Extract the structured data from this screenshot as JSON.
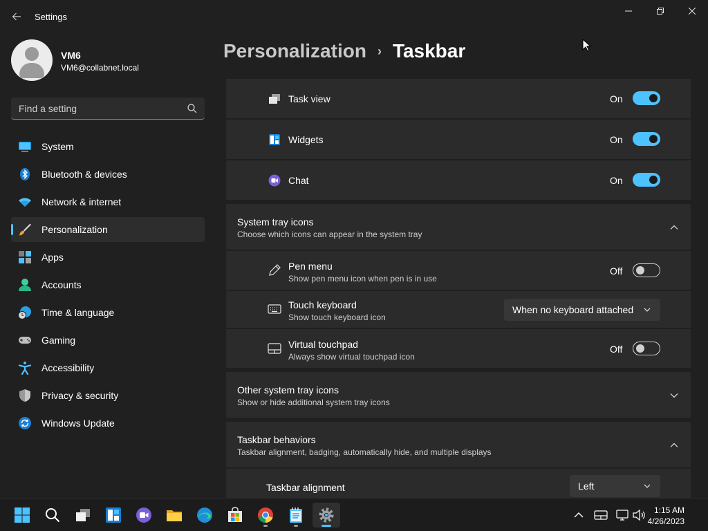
{
  "window": {
    "title": "Settings"
  },
  "user": {
    "name": "VM6",
    "email": "VM6@collabnet.local"
  },
  "search": {
    "placeholder": "Find a setting"
  },
  "sidebar": {
    "items": [
      {
        "label": "System",
        "icon": "system-icon"
      },
      {
        "label": "Bluetooth & devices",
        "icon": "bluetooth-icon"
      },
      {
        "label": "Network & internet",
        "icon": "wifi-icon"
      },
      {
        "label": "Personalization",
        "icon": "brush-icon",
        "active": true
      },
      {
        "label": "Apps",
        "icon": "apps-icon"
      },
      {
        "label": "Accounts",
        "icon": "accounts-icon"
      },
      {
        "label": "Time & language",
        "icon": "clock-globe-icon"
      },
      {
        "label": "Gaming",
        "icon": "gamepad-icon"
      },
      {
        "label": "Accessibility",
        "icon": "accessibility-icon"
      },
      {
        "label": "Privacy & security",
        "icon": "shield-icon"
      },
      {
        "label": "Windows Update",
        "icon": "update-icon"
      }
    ]
  },
  "breadcrumb": {
    "parent": "Personalization",
    "separator": "›",
    "current": "Taskbar"
  },
  "taskbar_items": {
    "task_view": {
      "label": "Task view",
      "state": "On"
    },
    "widgets": {
      "label": "Widgets",
      "state": "On"
    },
    "chat": {
      "label": "Chat",
      "state": "On"
    }
  },
  "system_tray": {
    "title": "System tray icons",
    "description": "Choose which icons can appear in the system tray",
    "pen_menu": {
      "label": "Pen menu",
      "description": "Show pen menu icon when pen is in use",
      "state": "Off"
    },
    "touch_keyboard": {
      "label": "Touch keyboard",
      "description": "Show touch keyboard icon",
      "value": "When no keyboard attached"
    },
    "virtual_touchpad": {
      "label": "Virtual touchpad",
      "description": "Always show virtual touchpad icon",
      "state": "Off"
    }
  },
  "other_tray": {
    "title": "Other system tray icons",
    "description": "Show or hide additional system tray icons"
  },
  "behaviors": {
    "title": "Taskbar behaviors",
    "description": "Taskbar alignment, badging, automatically hide, and multiple displays",
    "alignment": {
      "label": "Taskbar alignment",
      "value": "Left"
    }
  },
  "clock": {
    "time": "1:15 AM",
    "date": "4/26/2023"
  },
  "colors": {
    "accent": "#4cc2ff",
    "background": "#202020",
    "card": "#2b2b2b"
  }
}
